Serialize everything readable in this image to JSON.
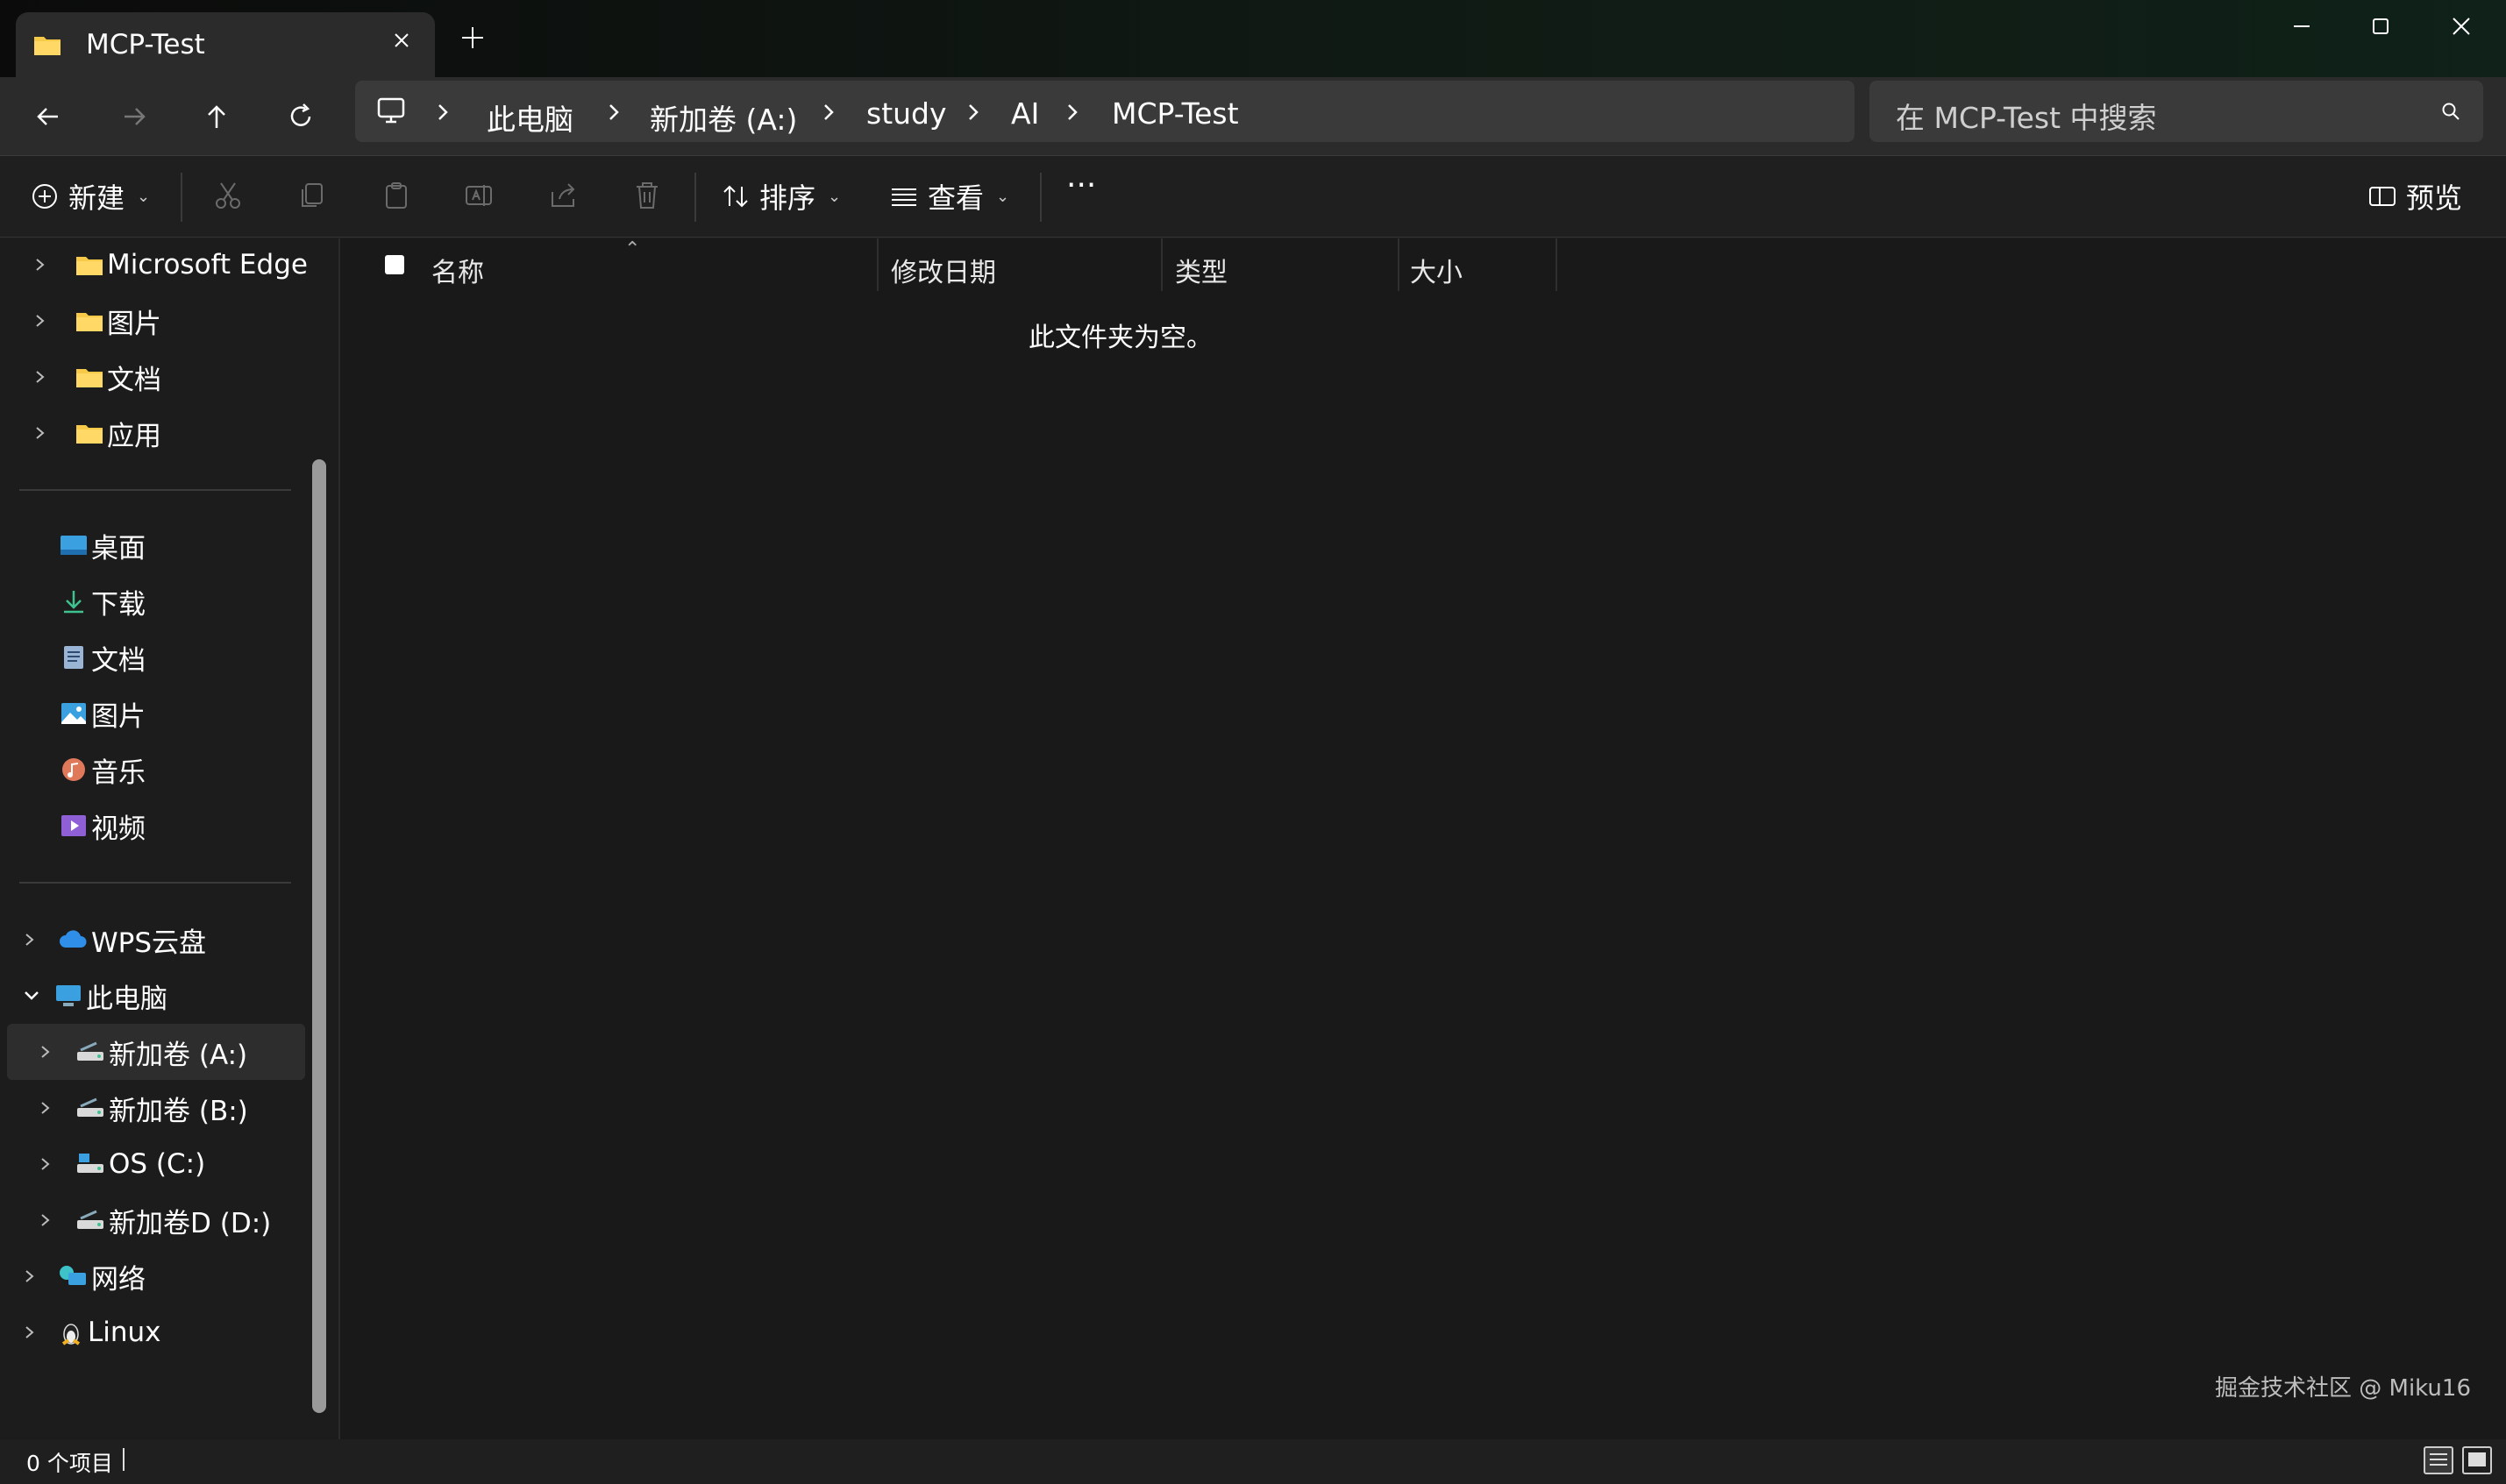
{
  "window": {
    "tab_title": "MCP-Test",
    "new_tab": "+"
  },
  "address": {
    "crumbs": [
      "此电脑",
      "新加卷 (A:)",
      "study",
      "AI",
      "MCP-Test"
    ],
    "search_placeholder": "在 MCP-Test 中搜索"
  },
  "toolbar": {
    "new_label": "新建",
    "sort_label": "排序",
    "view_label": "查看",
    "more_label": "···",
    "preview_label": "预览"
  },
  "sidebar": {
    "top_items": [
      "Microsoft Edge",
      "图片",
      "文档",
      "应用"
    ],
    "quick_access": [
      "桌面",
      "下载",
      "文档",
      "图片",
      "音乐",
      "视频"
    ],
    "locations": {
      "wps": "WPS云盘",
      "this_pc": "此电脑",
      "drives": [
        "新加卷 (A:)",
        "新加卷 (B:)",
        "OS (C:)",
        "新加卷D (D:)"
      ],
      "network": "网络",
      "linux": "Linux"
    }
  },
  "columns": {
    "name": "名称",
    "modified": "修改日期",
    "type": "类型",
    "size": "大小"
  },
  "content": {
    "empty_message": "此文件夹为空。"
  },
  "status": {
    "item_count": "0 个项目"
  },
  "watermark": "掘金技术社区 @ Miku16",
  "colors": {
    "background": "#191919",
    "folder": "#f7c948",
    "accent": "#4cc2ff"
  }
}
